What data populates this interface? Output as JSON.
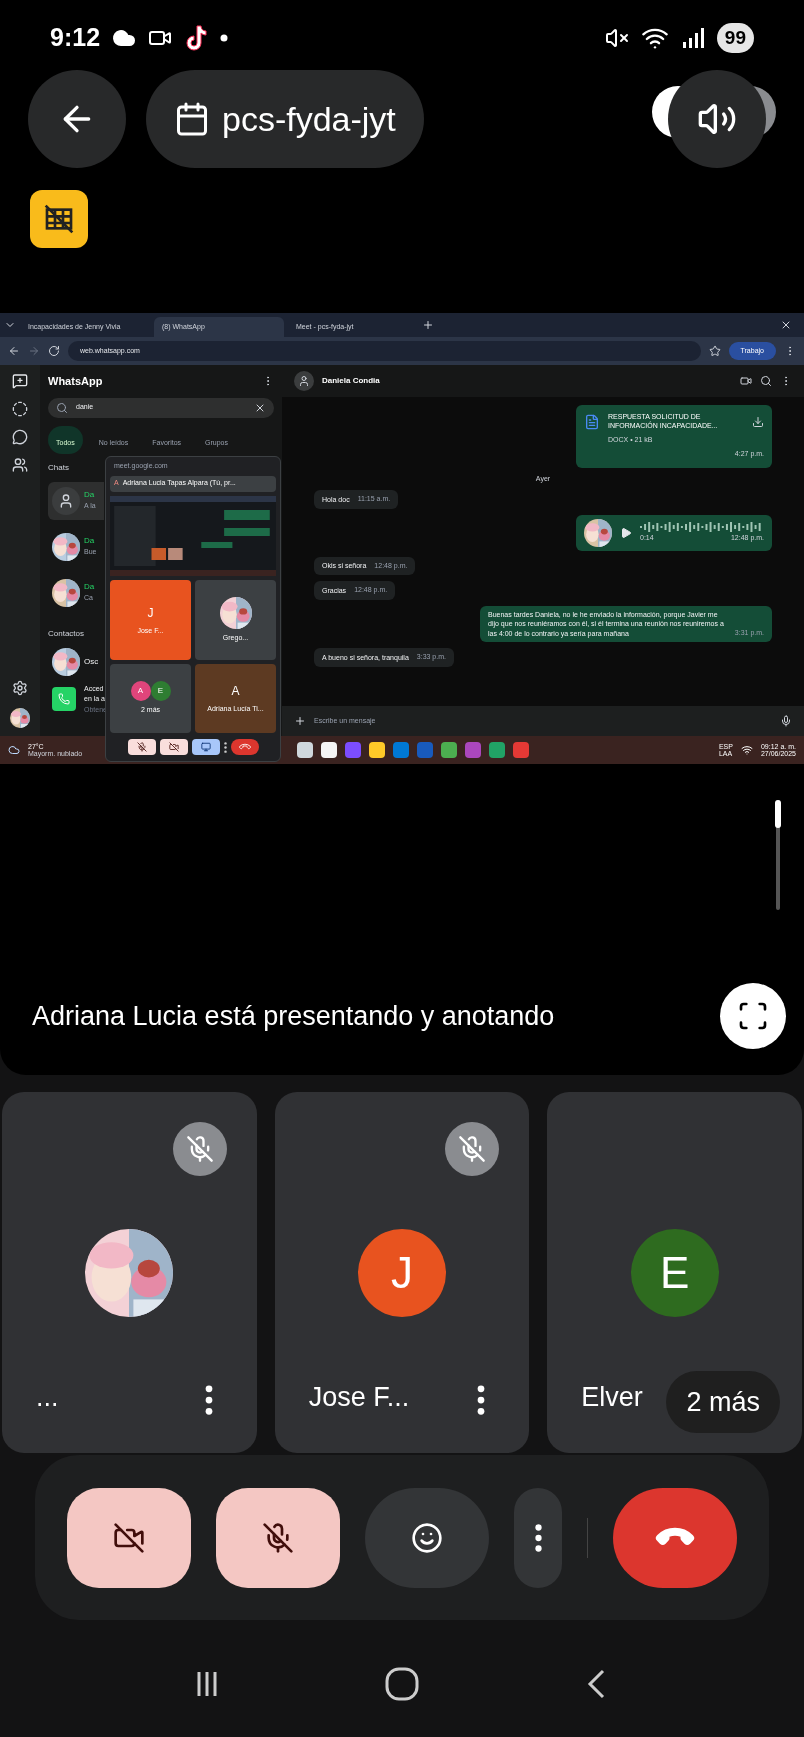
{
  "status_bar": {
    "time": "9:12",
    "battery": "99"
  },
  "meeting": {
    "code": "pcs-fyda-jyt"
  },
  "shared_screen": {
    "browser_tabs": [
      {
        "title": "Incapacidades de Jenny Vivia",
        "selected": false
      },
      {
        "title": "(8) WhatsApp",
        "selected": true
      },
      {
        "title": "Meet - pcs-fyda-jyt",
        "selected": false
      }
    ],
    "url": "web.whatsapp.com",
    "profile": "Trabajo",
    "app_title": "WhatsApp",
    "search": "danie",
    "filters": [
      {
        "label": "Todos",
        "selected": true
      },
      {
        "label": "No leídos",
        "selected": false
      },
      {
        "label": "Favoritos",
        "selected": false
      },
      {
        "label": "Grupos",
        "selected": false
      }
    ],
    "chats_heading": "Chats",
    "chats": [
      {
        "name": "Da",
        "preview": "A la",
        "selected": true,
        "kind": "placeholder"
      },
      {
        "name": "Da",
        "preview": "Bue",
        "selected": false,
        "kind": "picture"
      },
      {
        "name": "Da",
        "preview": "Ca",
        "selected": false,
        "kind": "picture"
      }
    ],
    "contacts_heading": "Contactos",
    "contact": {
      "name": "Osc"
    },
    "promo": [
      "Acced",
      "en la a",
      "Obtene"
    ],
    "chat_name": "Daniela Condia",
    "messages": [
      {
        "kind": "document",
        "outgoing": true,
        "text": "RESPUESTA SOLICITUD DE INFORMACIÓN INCAPACIDADE...",
        "meta": "DOCX • 21 kB",
        "time": "4:27 p.m."
      },
      {
        "kind": "date",
        "text": "Ayer"
      },
      {
        "kind": "text",
        "outgoing": false,
        "text": "Hola doc",
        "time": "11:15 a.m."
      },
      {
        "kind": "audio",
        "outgoing": true,
        "text": "0:14",
        "time": "12:48 p.m."
      },
      {
        "kind": "text",
        "outgoing": false,
        "text": "Okis si señora",
        "time": "12:48 p.m."
      },
      {
        "kind": "text",
        "outgoing": false,
        "text": "Gracias",
        "time": "12:48 p.m."
      },
      {
        "kind": "text",
        "outgoing": true,
        "text": "Buenas tardes Daniela, no le he enviado la información, porque Javier me dijo que nos reuniéramos con él, si él termina una reunión nos reuniremos a las 4:00 de lo contrario ya sería para mañana",
        "time": "3:31 p.m."
      },
      {
        "kind": "text",
        "outgoing": false,
        "text": "A bueno si señora, tranquila",
        "time": "3:33 p.m."
      }
    ],
    "composer_placeholder": "Escribe un mensaje",
    "pip": {
      "url": "meet.google.com",
      "presenter_initial": "A",
      "presenter": "Adriana Lucia Tapas Alpara (Tú, pr...",
      "tiles": [
        {
          "kind": "initial",
          "initial": "J",
          "name": "Jose F...",
          "color": "#e8531f"
        },
        {
          "kind": "picture",
          "name": "Grego..."
        },
        {
          "kind": "group",
          "initials": [
            {
              "initial": "A",
              "color": "#e0457b"
            },
            {
              "initial": "E",
              "color": "#2e7d32"
            }
          ],
          "name": "2 más"
        },
        {
          "kind": "initial",
          "initial": "A",
          "name": "Adriana Lucía Ti...",
          "color": "#5d3a22"
        }
      ]
    },
    "taskbar": {
      "temperature": "27°C",
      "weather": "Mayorm. nublado",
      "language": [
        "ESP",
        "LAA"
      ],
      "time": "09:12 a. m.",
      "date": "27/06/2025"
    }
  },
  "presenter_banner": "Adriana Lucia está presentando y anotando",
  "participants": [
    {
      "kind": "picture",
      "name": "...",
      "muted": true
    },
    {
      "kind": "initial",
      "initial": "J",
      "name": "Jose F...",
      "color": "#e8531f",
      "muted": true
    },
    {
      "kind": "initial",
      "initial": "E",
      "name": "Elver",
      "color": "#2e6b1f",
      "muted": false
    }
  ],
  "more_participants": "2 más",
  "controls": [
    {
      "kind": "camera",
      "on": false
    },
    {
      "kind": "mic",
      "on": false
    },
    {
      "kind": "reactions"
    },
    {
      "kind": "more"
    },
    {
      "kind": "hangup"
    }
  ]
}
